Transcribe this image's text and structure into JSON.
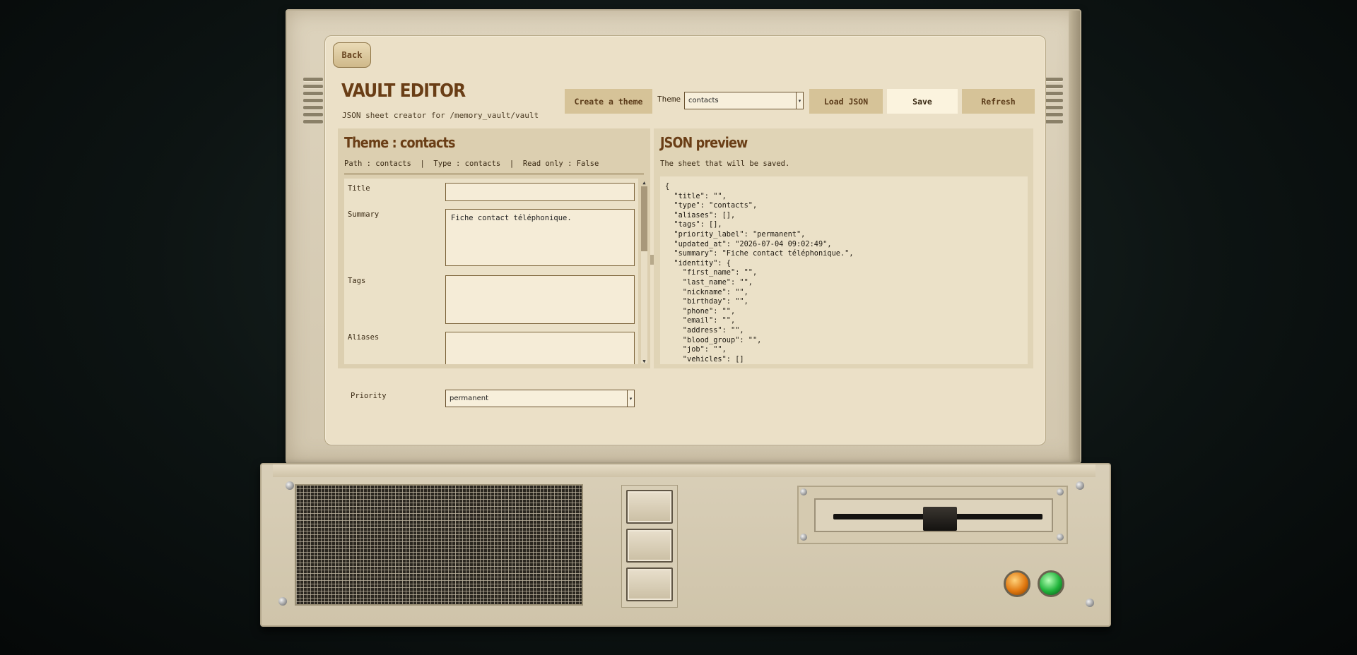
{
  "app": {
    "back_label": "Back",
    "title": "VAULT EDITOR",
    "subtitle": "JSON sheet creator for /memory_vault/vault"
  },
  "toolbar": {
    "create_theme_label": "Create a theme",
    "theme_label": "Theme",
    "theme_value": "contacts",
    "load_json_label": "Load JSON",
    "save_label": "Save",
    "refresh_label": "Refresh"
  },
  "theme_panel": {
    "title": "Theme : contacts",
    "meta": "Path : contacts  |  Type : contacts  |  Read only : False",
    "fields": {
      "title_label": "Title",
      "title_value": "",
      "summary_label": "Summary",
      "summary_value": "Fiche contact téléphonique.",
      "tags_label": "Tags",
      "tags_value": "",
      "aliases_label": "Aliases",
      "aliases_value": "",
      "priority_label": "Priority",
      "priority_value": "permanent"
    }
  },
  "json_panel": {
    "title": "JSON preview",
    "subtitle": "The sheet that will be saved.",
    "content": "{\n  \"title\": \"\",\n  \"type\": \"contacts\",\n  \"aliases\": [],\n  \"tags\": [],\n  \"priority_label\": \"permanent\",\n  \"updated_at\": \"2026-07-04 09:02:49\",\n  \"summary\": \"Fiche contact téléphonique.\",\n  \"identity\": {\n    \"first_name\": \"\",\n    \"last_name\": \"\",\n    \"nickname\": \"\",\n    \"birthday\": \"\",\n    \"phone\": \"\",\n    \"email\": \"\",\n    \"address\": \"\",\n    \"blood_group\": \"\",\n    \"job\": \"\",\n    \"vehicles\": []\n  },\n  \"relations\": {\n    \"related\": [],\n    \"owns\": [],\n    \"uses\": [],"
  },
  "colors": {
    "accent_brown": "#6a3e16",
    "button_tan": "#d6c398",
    "save_highlight": "#fbf3de",
    "led_orange": "#e07810",
    "led_green": "#1fb33a"
  }
}
